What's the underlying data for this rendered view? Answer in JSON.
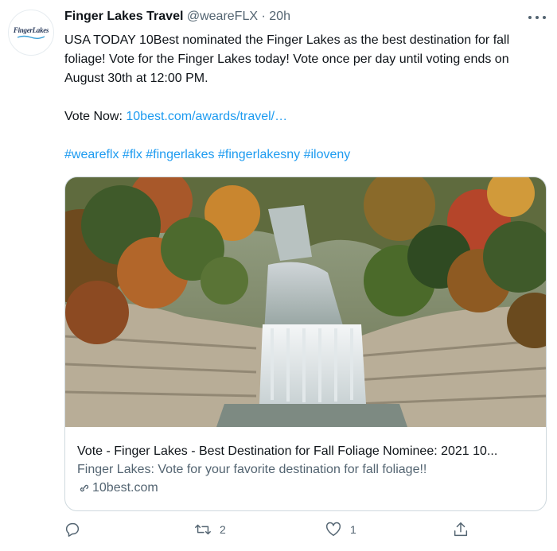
{
  "author": {
    "name": "Finger Lakes Travel",
    "handle": "@weareFLX",
    "separator": "·",
    "time": "20h",
    "avatar_text": "FingerLakes"
  },
  "tweet": {
    "text_line1": "USA TODAY 10Best nominated the Finger Lakes as the best destination for fall foliage! Vote for the Finger Lakes today! Vote once per day until voting ends on August 30th at 12:00 PM.",
    "vote_prefix": "Vote Now: ",
    "vote_link": "10best.com/awards/travel/…",
    "hashtags": "#weareflx #flx #fingerlakes #fingerlakesny #iloveny"
  },
  "card": {
    "image_icon": "waterfall-photo",
    "title": "Vote - Finger Lakes - Best Destination for Fall Foliage Nominee: 2021 10...",
    "description": "Finger Lakes: Vote for your favorite destination for fall foliage!!",
    "domain": "10best.com"
  },
  "actions": {
    "reply_count": "",
    "retweet_count": "2",
    "like_count": "1",
    "share_count": ""
  },
  "colors": {
    "link": "#1d9bf0",
    "text": "#0f1419",
    "muted": "#536471",
    "border": "#cfd9de"
  }
}
